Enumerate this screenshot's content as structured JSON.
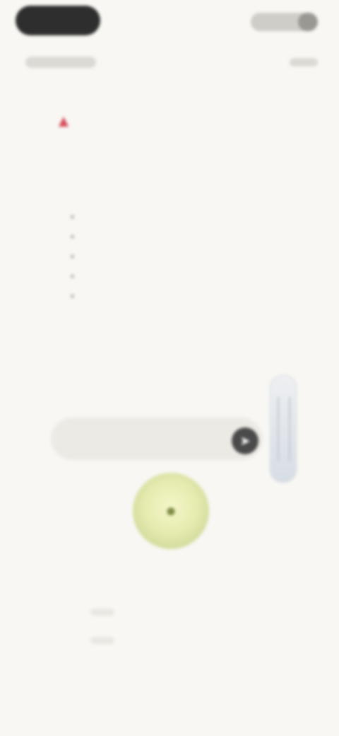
{
  "header": {
    "title_pill": "",
    "subtitle": "",
    "right_action": "",
    "right_sub": ""
  },
  "warning": {
    "icon": "alert-icon",
    "title": "",
    "subtitle": ""
  },
  "content": {
    "intro": "",
    "items": [
      "",
      "",
      "",
      "",
      ""
    ],
    "footer_prefix": "",
    "footer_link": "",
    "footer_suffix": ""
  },
  "caption": "",
  "composer": {
    "placeholder": "",
    "send_icon": "send-icon"
  },
  "orb": {
    "icon": "mic-icon"
  },
  "bottom_nav": {
    "items": [
      "",
      "",
      "",
      ""
    ]
  },
  "colors": {
    "background": "#f8f7f3",
    "warning_accent": "#d64c5a",
    "link": "#3f6db3",
    "send_button": "#4a4a4a",
    "orb": "#e6ebb0"
  }
}
